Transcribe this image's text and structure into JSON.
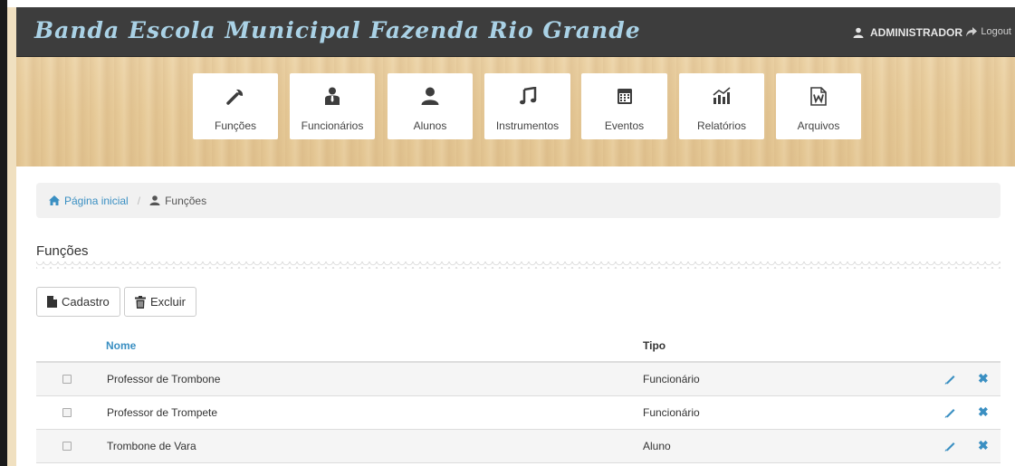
{
  "header": {
    "brand": "Banda Escola Municipal Fazenda Rio Grande",
    "user": "ADMINISTRADOR",
    "logout": "Logout"
  },
  "menu": [
    {
      "label": "Funções",
      "icon": "wrench-icon"
    },
    {
      "label": "Funcionários",
      "icon": "employee-icon"
    },
    {
      "label": "Alunos",
      "icon": "user-icon"
    },
    {
      "label": "Instrumentos",
      "icon": "music-icon"
    },
    {
      "label": "Eventos",
      "icon": "calendar-icon"
    },
    {
      "label": "Relatórios",
      "icon": "stats-icon"
    },
    {
      "label": "Arquivos",
      "icon": "word-file-icon"
    }
  ],
  "breadcrumb": {
    "home": "Página inicial",
    "current": "Funções"
  },
  "page": {
    "title": "Funções",
    "btn_cadastro": "Cadastro",
    "btn_excluir": "Excluir"
  },
  "table": {
    "columns": [
      "Nome",
      "Tipo"
    ],
    "rows": [
      {
        "nome": "Professor de Trombone",
        "tipo": "Funcionário"
      },
      {
        "nome": "Professor de Trompete",
        "tipo": "Funcionário"
      },
      {
        "nome": "Trombone de Vara",
        "tipo": "Aluno"
      }
    ]
  },
  "colors": {
    "navbar": "#3d3d3d",
    "brand": "#aad2e6",
    "link": "#3a8fc2"
  }
}
